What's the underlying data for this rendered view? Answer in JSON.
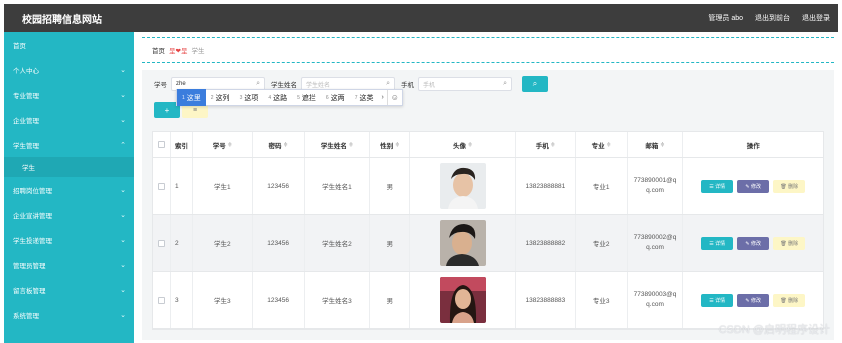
{
  "header": {
    "title": "校园招聘信息网站",
    "admin": "管理员 abo",
    "back_front": "退出到前台",
    "logout": "退出登录"
  },
  "sidebar": {
    "items": [
      {
        "label": "首页",
        "chevron": ""
      },
      {
        "label": "个人中心",
        "chevron": "⌄"
      },
      {
        "label": "专业管理",
        "chevron": "⌄"
      },
      {
        "label": "企业管理",
        "chevron": "⌄"
      },
      {
        "label": "学生管理",
        "chevron": "⌃"
      },
      {
        "label": "学生",
        "sub": true
      },
      {
        "label": "招聘岗位管理",
        "chevron": "⌄"
      },
      {
        "label": "企业宣讲管理",
        "chevron": "⌄"
      },
      {
        "label": "学生投递管理",
        "chevron": "⌄"
      },
      {
        "label": "管理员管理",
        "chevron": "⌄"
      },
      {
        "label": "留言板管理",
        "chevron": "⌄"
      },
      {
        "label": "系统管理",
        "chevron": "⌄"
      }
    ]
  },
  "breadcrumb": {
    "home": "首页",
    "accent": "呈❤呈",
    "current": "学生"
  },
  "search": {
    "label_xh": "学号",
    "value_xh": "zhe",
    "label_xm": "学生姓名",
    "placeholder_xm": "学生姓名",
    "label_sj": "手机",
    "placeholder_sj": "手机",
    "button_icon": "search-icon"
  },
  "ime": {
    "candidates": [
      {
        "num": "1",
        "text": "这里"
      },
      {
        "num": "2",
        "text": "这列"
      },
      {
        "num": "3",
        "text": "这项"
      },
      {
        "num": "4",
        "text": "这路"
      },
      {
        "num": "5",
        "text": "遮拦"
      },
      {
        "num": "6",
        "text": "这两"
      },
      {
        "num": "7",
        "text": "这类"
      }
    ],
    "more": "›",
    "emoji": "☺"
  },
  "actions": {
    "add": "+",
    "delete": "≡"
  },
  "table": {
    "headers": {
      "index": "索引",
      "xh": "学号",
      "mm": "密码",
      "xm": "学生姓名",
      "xb": "性别",
      "tx": "头像",
      "sj": "手机",
      "zy": "专业",
      "yx": "邮箱",
      "op": "操作",
      "sort": "≑"
    },
    "rows": [
      {
        "index": "1",
        "xh": "学生1",
        "mm": "123456",
        "xm": "学生姓名1",
        "xb": "男",
        "sj": "13823888881",
        "zy": "专业1",
        "yx1": "773890001@q",
        "yx2": "q.com"
      },
      {
        "index": "2",
        "xh": "学生2",
        "mm": "123456",
        "xm": "学生姓名2",
        "xb": "男",
        "sj": "13823888882",
        "zy": "专业2",
        "yx1": "773890002@q",
        "yx2": "q.com"
      },
      {
        "index": "3",
        "xh": "学生3",
        "mm": "123456",
        "xm": "学生姓名3",
        "xb": "男",
        "sj": "13823888883",
        "zy": "专业3",
        "yx1": "773890003@q",
        "yx2": "q.com"
      }
    ],
    "ops": {
      "detail": "☰ 详情",
      "edit": "✎ 修改",
      "del": "🗑 删除"
    }
  },
  "watermark": "CSDN @启明程序设计",
  "colors": {
    "accent": "#23b7c4",
    "header": "#3d3d3d",
    "edit": "#6c6ea8",
    "danger_bg": "#fdf6c6"
  }
}
